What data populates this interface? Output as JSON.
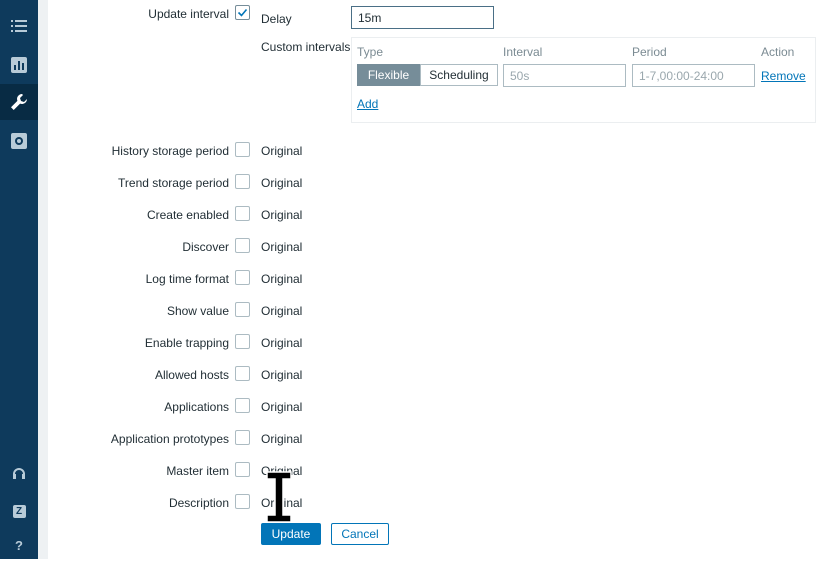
{
  "sidebar": {
    "items": [
      "list-icon",
      "chart-icon",
      "wrench-icon",
      "gear-icon"
    ],
    "bottom": [
      "support-icon",
      "zabbix-share-icon",
      "help-icon"
    ],
    "help_label": "?",
    "share_label": "Z"
  },
  "update_interval": {
    "label": "Update interval",
    "checked": true,
    "delay_label": "Delay",
    "delay_value": "15m",
    "custom_label": "Custom intervals",
    "columns": [
      "Type",
      "Interval",
      "Period",
      "Action"
    ],
    "row": {
      "type_options": [
        "Flexible",
        "Scheduling"
      ],
      "type_selected": "Flexible",
      "interval_placeholder": "50s",
      "period_placeholder": "1-7,00:00-24:00",
      "remove_label": "Remove"
    },
    "add_label": "Add"
  },
  "rows": [
    {
      "label": "History storage period",
      "value": "Original"
    },
    {
      "label": "Trend storage period",
      "value": "Original"
    },
    {
      "label": "Create enabled",
      "value": "Original"
    },
    {
      "label": "Discover",
      "value": "Original"
    },
    {
      "label": "Log time format",
      "value": "Original"
    },
    {
      "label": "Show value",
      "value": "Original"
    },
    {
      "label": "Enable trapping",
      "value": "Original"
    },
    {
      "label": "Allowed hosts",
      "value": "Original"
    },
    {
      "label": "Applications",
      "value": "Original"
    },
    {
      "label": "Application prototypes",
      "value": "Original"
    },
    {
      "label": "Master item",
      "value": "Original"
    },
    {
      "label": "Description",
      "value": "Original"
    }
  ],
  "buttons": {
    "update": "Update",
    "cancel": "Cancel"
  },
  "colors": {
    "sidebar": "#0e3a5c",
    "primary": "#0275b8",
    "selected_segment": "#768d99"
  }
}
